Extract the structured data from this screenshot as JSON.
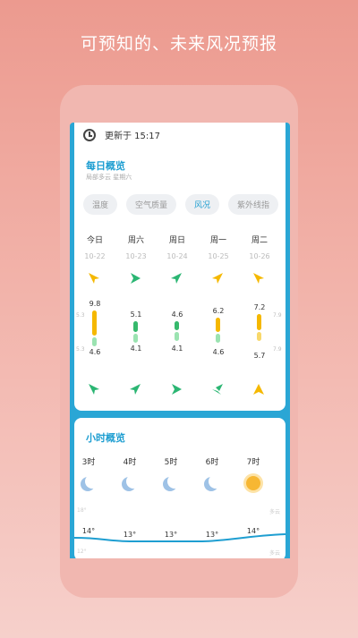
{
  "headline": "可预知的、未来风况预报",
  "daily_card": {
    "update_label": "更新于 15:17",
    "title": "每日概览",
    "subtitle": "局部多云 星期六",
    "tabs": [
      {
        "label": "温度",
        "active": false
      },
      {
        "label": "空气质量",
        "active": false
      },
      {
        "label": "风况",
        "active": true
      },
      {
        "label": "紫外线指",
        "active": false
      }
    ],
    "days": [
      {
        "name": "今日",
        "date": "10-22",
        "high": "9.8",
        "low": "4.6"
      },
      {
        "name": "周六",
        "date": "10-23",
        "high": "5.1",
        "low": "4.1"
      },
      {
        "name": "周日",
        "date": "10-24",
        "high": "4.6",
        "low": "4.1"
      },
      {
        "name": "周一",
        "date": "10-25",
        "high": "6.2",
        "low": "4.6"
      },
      {
        "name": "周二",
        "date": "10-26",
        "high": "7.2",
        "low": "5.7"
      }
    ],
    "axis_labels": {
      "left_top": "5.3",
      "left_bottom": "5.3",
      "right_top": "7.9",
      "right_bottom": "7.9"
    }
  },
  "hourly_card": {
    "title": "小时概览",
    "hours": [
      {
        "label": "3时",
        "icon": "moon-icon",
        "temp": "14°"
      },
      {
        "label": "4时",
        "icon": "moon-icon",
        "temp": "13°"
      },
      {
        "label": "5时",
        "icon": "moon-icon",
        "temp": "13°"
      },
      {
        "label": "6时",
        "icon": "moon-icon",
        "temp": "13°"
      },
      {
        "label": "7时",
        "icon": "sun-icon",
        "temp": "14°"
      }
    ],
    "axis_labels": {
      "left_top": "18°",
      "left_bottom": "12°",
      "right_top": "多云",
      "right_bottom": "多云"
    }
  },
  "colors": {
    "accent": "#1e9ed1",
    "arrow_green": "#2bb673",
    "arrow_yellow": "#f5b800",
    "bar_yellow": "#f5b800",
    "bar_green": "#36b96c"
  }
}
